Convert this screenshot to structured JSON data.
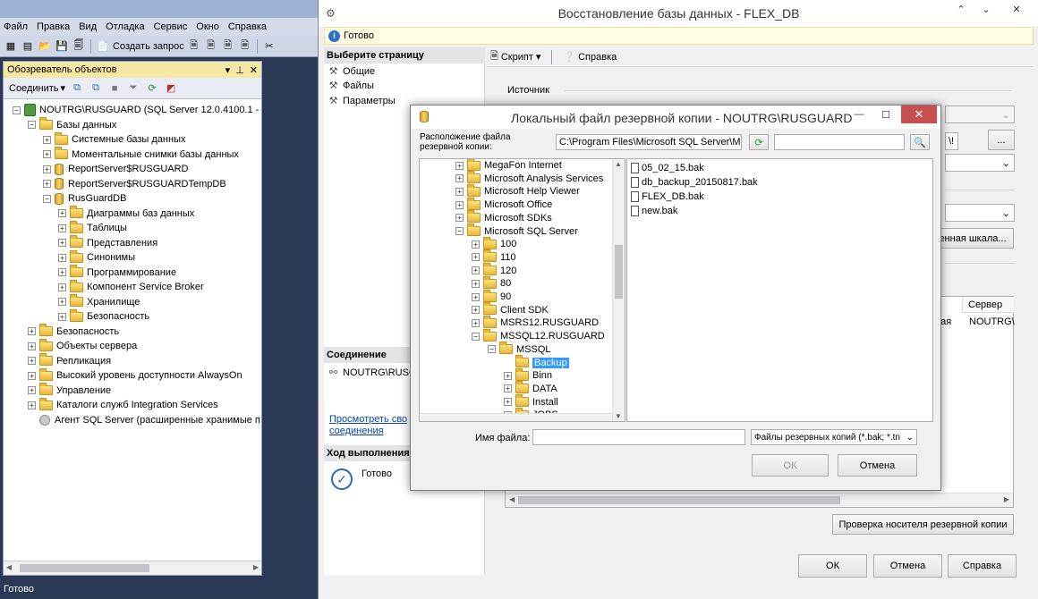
{
  "ssms": {
    "menu": [
      "Файл",
      "Правка",
      "Вид",
      "Отладка",
      "Сервис",
      "Окно",
      "Справка"
    ],
    "toolbar_new_query": "Создать запрос",
    "object_explorer": {
      "title": "Обозреватель объектов",
      "connect_label": "Соединить",
      "tree": [
        {
          "level": 0,
          "label": "NOUTRG\\RUSGUARD (SQL Server 12.0.4100.1 - sa)",
          "icon": "server",
          "expand": "-"
        },
        {
          "level": 1,
          "label": "Базы данных",
          "icon": "folder",
          "expand": "-"
        },
        {
          "level": 2,
          "label": "Системные базы данных",
          "icon": "folder",
          "expand": "+"
        },
        {
          "level": 2,
          "label": "Моментальные снимки базы данных",
          "icon": "folder",
          "expand": "+"
        },
        {
          "level": 2,
          "label": "ReportServer$RUSGUARD",
          "icon": "db",
          "expand": "+"
        },
        {
          "level": 2,
          "label": "ReportServer$RUSGUARDTempDB",
          "icon": "db",
          "expand": "+"
        },
        {
          "level": 2,
          "label": "RusGuardDB",
          "icon": "db",
          "expand": "-"
        },
        {
          "level": 3,
          "label": "Диаграммы баз данных",
          "icon": "folder",
          "expand": "+"
        },
        {
          "level": 3,
          "label": "Таблицы",
          "icon": "folder",
          "expand": "+"
        },
        {
          "level": 3,
          "label": "Представления",
          "icon": "folder",
          "expand": "+"
        },
        {
          "level": 3,
          "label": "Синонимы",
          "icon": "folder",
          "expand": "+"
        },
        {
          "level": 3,
          "label": "Программирование",
          "icon": "folder",
          "expand": "+"
        },
        {
          "level": 3,
          "label": "Компонент Service Broker",
          "icon": "folder",
          "expand": "+"
        },
        {
          "level": 3,
          "label": "Хранилище",
          "icon": "folder",
          "expand": "+"
        },
        {
          "level": 3,
          "label": "Безопасность",
          "icon": "folder",
          "expand": "+"
        },
        {
          "level": 1,
          "label": "Безопасность",
          "icon": "folder",
          "expand": "+"
        },
        {
          "level": 1,
          "label": "Объекты сервера",
          "icon": "folder",
          "expand": "+"
        },
        {
          "level": 1,
          "label": "Репликация",
          "icon": "folder",
          "expand": "+"
        },
        {
          "level": 1,
          "label": "Высокий уровень доступности AlwaysOn",
          "icon": "folder",
          "expand": "+"
        },
        {
          "level": 1,
          "label": "Управление",
          "icon": "folder",
          "expand": "+"
        },
        {
          "level": 1,
          "label": "Каталоги служб Integration Services",
          "icon": "folder",
          "expand": "+"
        },
        {
          "level": 1,
          "label": "Агент SQL Server (расширенные хранимые п",
          "icon": "agent",
          "expand": ""
        }
      ]
    },
    "status": "Готово"
  },
  "restore": {
    "title": "Восстановление базы данных - FLEX_DB",
    "info": "Готово",
    "select_page_header": "Выберите страницу",
    "pages": [
      "Общие",
      "Файлы",
      "Параметры"
    ],
    "script_label": "Скрипт",
    "help_label": "Справка",
    "source_label": "Источник",
    "browse_label": "...",
    "timeline_label": "енная шкала...",
    "grid_header_server": "Сервер",
    "grid_cell_type": "ная",
    "grid_cell_server": "NOUTRG\\",
    "path_fragment": "\\!",
    "connection_header": "Соединение",
    "connection_value": "NOUTRG\\RUSG",
    "view_link_line1": "Просмотреть сво",
    "view_link_line2": "соединения",
    "progress_header": "Ход выполнения",
    "progress_status": "Готово",
    "verify_button": "Проверка носителя резервной копии",
    "ok_button": "ОК",
    "cancel_button": "Отмена",
    "help_button": "Справка"
  },
  "backup_dialog": {
    "title": "Локальный файл резервной копии - NOUTRG\\RUSGUARD",
    "location_label": "Расположение файла резервной копии:",
    "location_value": "C:\\Program Files\\Microsoft SQL Server\\MSSQ",
    "search_value": "",
    "tree": [
      {
        "level": 0,
        "label": "MegaFon Internet",
        "expand": "+"
      },
      {
        "level": 0,
        "label": "Microsoft Analysis Services",
        "expand": "+"
      },
      {
        "level": 0,
        "label": "Microsoft Help Viewer",
        "expand": "+"
      },
      {
        "level": 0,
        "label": "Microsoft Office",
        "expand": "+"
      },
      {
        "level": 0,
        "label": "Microsoft SDKs",
        "expand": "+"
      },
      {
        "level": 0,
        "label": "Microsoft SQL Server",
        "expand": "-"
      },
      {
        "level": 1,
        "label": "100",
        "expand": "+"
      },
      {
        "level": 1,
        "label": "110",
        "expand": "+"
      },
      {
        "level": 1,
        "label": "120",
        "expand": "+"
      },
      {
        "level": 1,
        "label": "80",
        "expand": "+"
      },
      {
        "level": 1,
        "label": "90",
        "expand": "+"
      },
      {
        "level": 1,
        "label": "Client SDK",
        "expand": "+"
      },
      {
        "level": 1,
        "label": "MSRS12.RUSGUARD",
        "expand": "+"
      },
      {
        "level": 1,
        "label": "MSSQL12.RUSGUARD",
        "expand": "-"
      },
      {
        "level": 2,
        "label": "MSSQL",
        "expand": "-"
      },
      {
        "level": 3,
        "label": "Backup",
        "expand": "",
        "selected": true
      },
      {
        "level": 3,
        "label": "Binn",
        "expand": "+"
      },
      {
        "level": 3,
        "label": "DATA",
        "expand": "+"
      },
      {
        "level": 3,
        "label": "Install",
        "expand": "+"
      },
      {
        "level": 3,
        "label": "JOBS",
        "expand": "+"
      }
    ],
    "files": [
      "05_02_15.bak",
      "db_backup_20150817.bak",
      "FLEX_DB.bak",
      "new.bak"
    ],
    "filename_label": "Имя файла:",
    "filename_value": "",
    "filter_value": "Файлы резервных копий (*.bak; *.tn",
    "ok_button": "ОК",
    "cancel_button": "Отмена"
  }
}
